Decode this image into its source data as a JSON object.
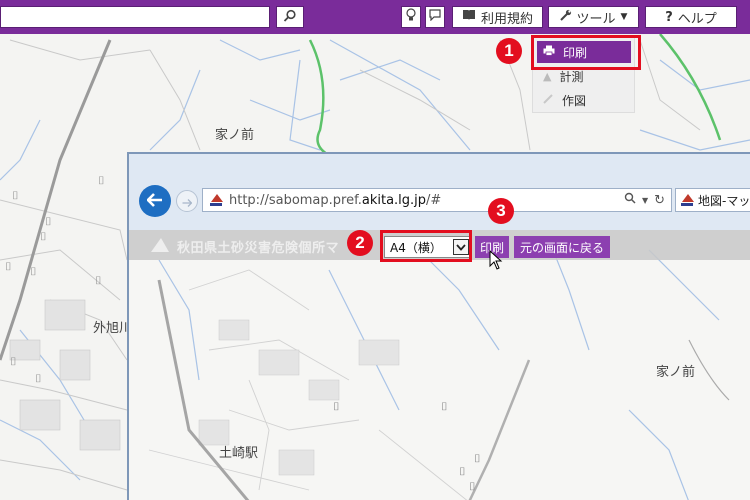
{
  "toolbar": {
    "search_placeholder": "",
    "terms_label": "利用規約",
    "tools_label": "ツール",
    "help_label": "ヘルプ"
  },
  "tools_menu": {
    "items": [
      {
        "label": "印刷",
        "icon": "printer-icon",
        "active": true
      },
      {
        "label": "計測",
        "icon": "ruler-icon",
        "active": false
      },
      {
        "label": "作図",
        "icon": "pencil-icon",
        "active": false
      }
    ]
  },
  "steps": {
    "one": "1",
    "two": "2",
    "three": "3"
  },
  "background_map": {
    "labels": [
      "家ノ前",
      "外旭川"
    ]
  },
  "print_window": {
    "url_prefix": "http://sabomap.pref.",
    "url_domain": "akita.lg.jp",
    "url_suffix": "/#",
    "tab_title": "地図-マッ",
    "site_title": "秋田県土砂災害危険個所マ",
    "paper_size": "A4（横）",
    "print_label": "印刷",
    "return_label": "元の画面に戻る",
    "map_labels": [
      "家ノ前",
      "土崎駅"
    ]
  },
  "colors": {
    "brand_purple": "#7a2c9a",
    "button_purple": "#8c3fb0",
    "highlight_red": "#e30e1f",
    "browser_blue": "#1e6ec2"
  }
}
